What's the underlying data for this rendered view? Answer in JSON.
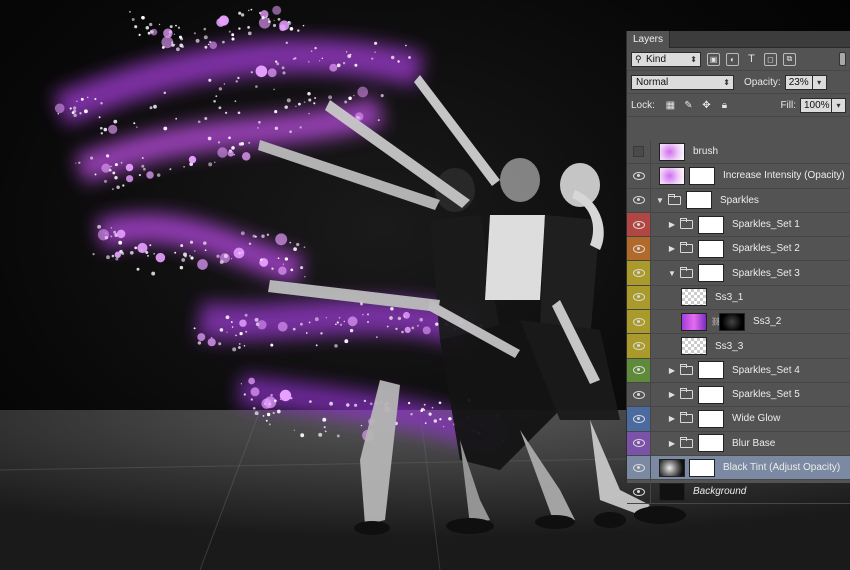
{
  "panel": {
    "tab_label": "Layers",
    "filter_kind": "Kind",
    "blend_mode": "Normal",
    "opacity_label": "Opacity:",
    "opacity_value": "23%",
    "lock_label": "Lock:",
    "fill_label": "Fill:",
    "fill_value": "100%"
  },
  "layers": [
    {
      "name": "brush",
      "visible": false,
      "depth": 0,
      "kind": "layer",
      "thumb": "purple-check",
      "mask": false,
      "color": ""
    },
    {
      "name": "Increase Intensity (Opacity)",
      "visible": true,
      "depth": 0,
      "kind": "layer",
      "thumb": "purple-check",
      "mask": "white",
      "color": ""
    },
    {
      "name": "Sparkles",
      "visible": true,
      "depth": 0,
      "kind": "folder-open",
      "thumb": "white",
      "mask": false,
      "color": ""
    },
    {
      "name": "Sparkles_Set 1",
      "visible": true,
      "depth": 1,
      "kind": "folder",
      "thumb": "white",
      "mask": false,
      "color": "#b14643"
    },
    {
      "name": "Sparkles_Set 2",
      "visible": true,
      "depth": 1,
      "kind": "folder",
      "thumb": "white",
      "mask": false,
      "color": "#b26a2a"
    },
    {
      "name": "Sparkles_Set 3",
      "visible": true,
      "depth": 1,
      "kind": "folder-open",
      "thumb": "white",
      "mask": false,
      "color": "#a99a2b"
    },
    {
      "name": "Ss3_1",
      "visible": true,
      "depth": 2,
      "kind": "layer",
      "thumb": "checker",
      "mask": false,
      "color": "#a99a2b"
    },
    {
      "name": "Ss3_2",
      "visible": true,
      "depth": 2,
      "kind": "layer",
      "thumb": "purple",
      "mask": "black",
      "color": "#a99a2b"
    },
    {
      "name": "Ss3_3",
      "visible": true,
      "depth": 2,
      "kind": "layer",
      "thumb": "checker",
      "mask": false,
      "color": "#a99a2b"
    },
    {
      "name": "Sparkles_Set 4",
      "visible": true,
      "depth": 1,
      "kind": "folder",
      "thumb": "white",
      "mask": false,
      "color": "#5e8a3a"
    },
    {
      "name": "Sparkles_Set 5",
      "visible": true,
      "depth": 1,
      "kind": "folder",
      "thumb": "white",
      "mask": false,
      "color": ""
    },
    {
      "name": "Wide Glow",
      "visible": true,
      "depth": 1,
      "kind": "folder",
      "thumb": "white",
      "mask": false,
      "color": "#4b6aa0"
    },
    {
      "name": "Blur Base",
      "visible": true,
      "depth": 1,
      "kind": "folder",
      "thumb": "white",
      "mask": false,
      "color": "#7a52a8"
    },
    {
      "name": "Black Tint (Adjust Opacity)",
      "visible": true,
      "depth": 0,
      "kind": "layer",
      "thumb": "bw",
      "mask": "white",
      "color": "",
      "active": true
    },
    {
      "name": "Background",
      "visible": true,
      "depth": 0,
      "kind": "layer",
      "thumb": "dark",
      "mask": false,
      "color": "",
      "italic": true
    }
  ]
}
